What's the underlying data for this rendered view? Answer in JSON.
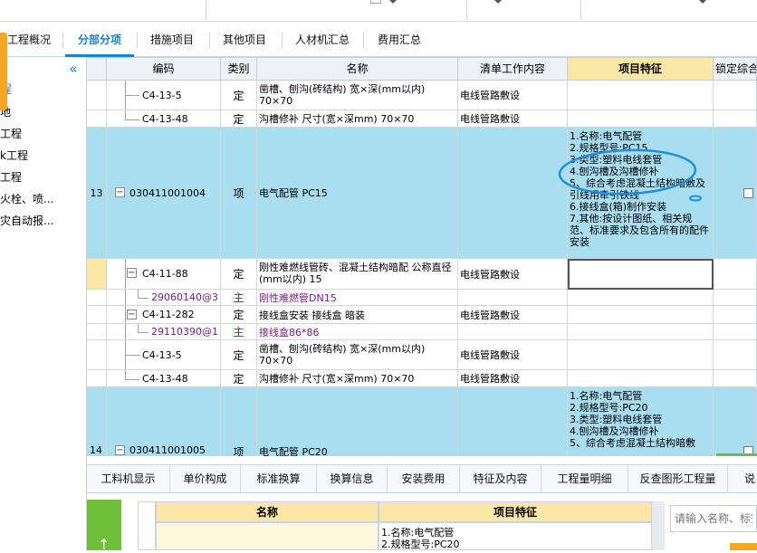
{
  "tabs": [
    {
      "label": "工程概况",
      "active": false
    },
    {
      "label": "分部分项",
      "active": true
    },
    {
      "label": "措施项目",
      "active": false
    },
    {
      "label": "其他项目",
      "active": false
    },
    {
      "label": "人材机汇总",
      "active": false
    },
    {
      "label": "费用汇总",
      "active": false
    }
  ],
  "left_tree": {
    "collapse_icon": "double-chevron-left",
    "items": [
      "程",
      "地",
      "工程",
      "k工程",
      "工程",
      "火栓、喷...",
      "灾自动报..."
    ]
  },
  "grid": {
    "headers": {
      "code": "编码",
      "type": "类别",
      "name": "名称",
      "work": "清单工作内容",
      "feature": "项目特征",
      "lock": "锁定综合"
    },
    "rows": [
      {
        "code": "C4-13-5",
        "type": "定",
        "name": "凿槽、刨沟(砖结构) 宽×深(mm以内) 70×70",
        "work": "电线管路敷设"
      },
      {
        "code": "C4-13-48",
        "type": "定",
        "name": "沟槽修补 尺寸(宽×深mm) 70×70",
        "work": "电线管路敷设"
      },
      {
        "num": "13",
        "code": "030411001004",
        "type": "项",
        "name": "电气配管 PC15",
        "work": "",
        "feature": [
          "1.名称:电气配管",
          "2.规格型号:PC15",
          "3.类型:塑料电线套管",
          "4.刨沟槽及沟槽修补",
          "5、综合考虑混凝土结构暗敷及引线用牵引铁线",
          "6.接线盒(箱)制作安装",
          "7.其他:按设计图纸、相关规范、标准要求及包含所有的配件安装"
        ]
      },
      {
        "code": "C4-11-88",
        "type": "定",
        "name": "刚性难燃线管砖、混凝土结构暗配 公称直径(mm以内) 15",
        "work": "电线管路敷设"
      },
      {
        "code": "29060140@3",
        "type": "主",
        "name": "刚性难燃管DN15",
        "work": ""
      },
      {
        "code": "C4-11-282",
        "type": "定",
        "name": "接线盒安装 接线盒 暗装",
        "work": "电线管路敷设"
      },
      {
        "code": "29110390@1",
        "type": "主",
        "name": "接线盒86*86",
        "work": ""
      },
      {
        "code": "C4-13-5",
        "type": "定",
        "name": "凿槽、刨沟(砖结构) 宽×深(mm以内) 70×70",
        "work": "电线管路敷设"
      },
      {
        "code": "C4-13-48",
        "type": "定",
        "name": "沟槽修补 尺寸(宽×深mm) 70×70",
        "work": "电线管路敷设"
      },
      {
        "num": "14",
        "code": "030411001005",
        "type": "项",
        "name": "电气配管 PC20",
        "work": "",
        "feature": [
          "1.名称:电气配管",
          "2.规格型号:PC20",
          "3.类型:塑料电线套管",
          "4.刨沟槽及沟槽修补",
          "5、综合考虑混凝土结构暗敷"
        ]
      }
    ]
  },
  "bottom_toolbar": [
    "工料机显示",
    "单价构成",
    "标准换算",
    "换算信息",
    "安装费用",
    "特征及内容",
    "工程量明细",
    "反查图形工程量",
    "说"
  ],
  "bottom_panel": {
    "header_name": "名称",
    "header_feature": "项目特征",
    "feature_lines": [
      "1.名称:电气配管",
      "2.规格型号:PC20"
    ],
    "search_placeholder": "请输入名称、标签",
    "up_arrow": "↑"
  },
  "colors": {
    "accent": "#1c7fd6",
    "selected_row": "#a9def1",
    "material_text": "#7b1d8a",
    "annotation": "#1f8fe0"
  }
}
